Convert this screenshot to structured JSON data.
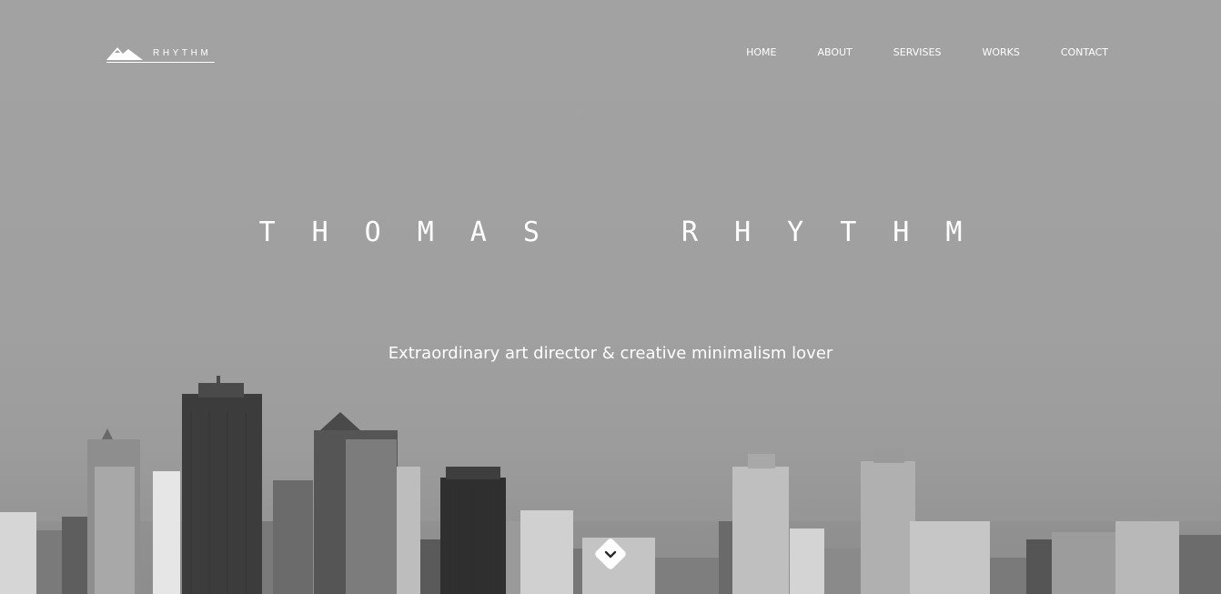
{
  "logo": {
    "text": "RHYTHM",
    "icon": "mountain-icon"
  },
  "nav": {
    "items": [
      {
        "label": "HOME"
      },
      {
        "label": "ABOUT"
      },
      {
        "label": "SERVISES"
      },
      {
        "label": "WORKS"
      },
      {
        "label": "CONTACT"
      }
    ]
  },
  "hero": {
    "title": "THOMAS  RHYTHM",
    "subtitle": "Extraordinary art director & creative minimalism lover",
    "scroll_icon": "chevron-down-icon"
  },
  "colors": {
    "sky": "#a0a0a0",
    "text": "#ffffff",
    "buildings_dark": "#3a3a3a",
    "buildings_light": "#cfcfcf"
  }
}
